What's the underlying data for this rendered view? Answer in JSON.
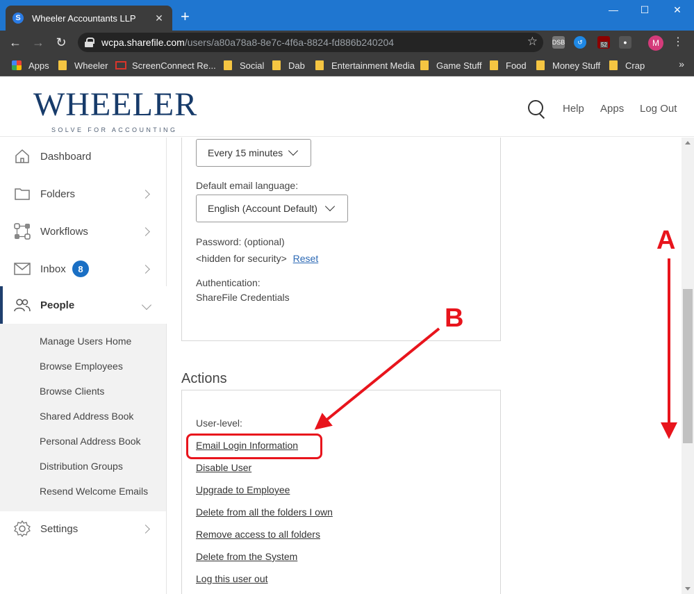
{
  "browser": {
    "tab_title": "Wheeler Accountants LLP",
    "tab_icon": "sharefile-favicon",
    "url_host": "wcpa.sharefile.com",
    "url_path": "/users/a80a78a8-8e7c-4f6a-8824-fd886b240204",
    "bookmarks": [
      "Apps",
      "Wheeler",
      "ScreenConnect Re...",
      "Social",
      "Dab",
      "Entertainment Media",
      "Game Stuff",
      "Food",
      "Money Stuff",
      "Crap"
    ],
    "extension_badge": "52",
    "profile_initial": "M",
    "accent": "#1f76d0"
  },
  "header": {
    "logo_text": "WHEELER",
    "logo_tagline": "SOLVE FOR ACCOUNTING",
    "links": [
      "Help",
      "Apps",
      "Log Out"
    ]
  },
  "sidebar": {
    "items": [
      {
        "label": "Dashboard",
        "icon": "home-icon"
      },
      {
        "label": "Folders",
        "icon": "folder-icon"
      },
      {
        "label": "Workflows",
        "icon": "workflow-icon"
      },
      {
        "label": "Inbox",
        "icon": "envelope-icon",
        "badge": "8"
      },
      {
        "label": "People",
        "icon": "people-icon",
        "active": true
      },
      {
        "label": "Settings",
        "icon": "gear-icon"
      }
    ],
    "people_submenu": [
      "Manage Users Home",
      "Browse Employees",
      "Browse Clients",
      "Shared Address Book",
      "Personal Address Book",
      "Distribution Groups",
      "Resend Welcome Emails"
    ]
  },
  "settings_panel": {
    "frequency_value": "Every 15 minutes",
    "email_language_label": "Default email language:",
    "email_language_value": "English (Account Default)",
    "password_label": "Password: (optional)",
    "password_value": "<hidden for security>",
    "reset_link": "Reset",
    "auth_label": "Authentication:",
    "auth_value": "ShareFile Credentials"
  },
  "actions": {
    "title": "Actions",
    "level_label": "User-level:",
    "links": [
      "Email Login Information",
      "Disable User",
      "Upgrade to Employee",
      "Delete from all the folders I own",
      "Remove access to all folders",
      "Delete from the System",
      "Log this user out"
    ]
  },
  "annotations": {
    "label_a": "A",
    "label_b": "B",
    "color": "#e8141c"
  }
}
